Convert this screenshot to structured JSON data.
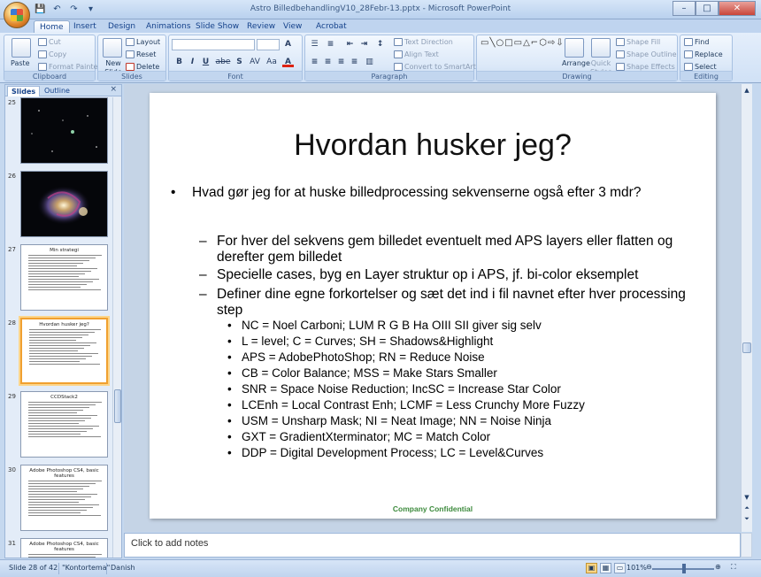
{
  "window": {
    "title": "Astro BilledbehandlingV10_28Febr-13.pptx - Microsoft PowerPoint",
    "minimize": "–",
    "maximize": "□",
    "close": "✕"
  },
  "qat": {
    "save": "💾",
    "undo": "↶",
    "redo": "↷",
    "more": "▾"
  },
  "tabs": [
    "Home",
    "Insert",
    "Design",
    "Animations",
    "Slide Show",
    "Review",
    "View",
    "Acrobat"
  ],
  "active_tab": "Home",
  "ribbon": {
    "clipboard": {
      "label": "Clipboard",
      "paste": "Paste",
      "cut": "Cut",
      "copy": "Copy",
      "format_painter": "Format Painter"
    },
    "slides": {
      "label": "Slides",
      "new_slide": "New Slide",
      "layout": "Layout",
      "reset": "Reset",
      "delete": "Delete"
    },
    "font": {
      "label": "Font",
      "bold": "B",
      "italic": "I",
      "underline": "U",
      "strike": "abe",
      "shadow": "S",
      "spacing": "AV",
      "case": "Aa",
      "color": "A"
    },
    "paragraph": {
      "label": "Paragraph",
      "text_direction": "Text Direction",
      "align_text": "Align Text",
      "convert_smartart": "Convert to SmartArt"
    },
    "drawing": {
      "label": "Drawing",
      "arrange": "Arrange",
      "quick_styles": "Quick Styles",
      "shape_fill": "Shape Fill",
      "shape_outline": "Shape Outline",
      "shape_effects": "Shape Effects"
    },
    "editing": {
      "label": "Editing",
      "find": "Find",
      "replace": "Replace",
      "select": "Select"
    }
  },
  "left_pane": {
    "tab_slides": "Slides",
    "tab_outline": "Outline",
    "close": "×",
    "thumbs": [
      {
        "num": "25",
        "title": "",
        "kind": "stars"
      },
      {
        "num": "26",
        "title": "",
        "kind": "galaxy"
      },
      {
        "num": "27",
        "title": "Min strategi",
        "kind": "text"
      },
      {
        "num": "28",
        "title": "Hvordan husker jeg?",
        "kind": "text",
        "selected": true
      },
      {
        "num": "29",
        "title": "CCDStack2",
        "kind": "text"
      },
      {
        "num": "30",
        "title": "Adobe Photoshop CS4, basic features",
        "kind": "text"
      },
      {
        "num": "31",
        "title": "Adobe Photoshop CS4, basic features",
        "kind": "text"
      }
    ]
  },
  "slide": {
    "title": "Hvordan husker jeg?",
    "bullet1": "Hvad gør jeg for at huske billedprocessing sekvenserne også efter 3 mdr?",
    "sub": [
      "For hver del sekvens gem billedet eventuelt med APS layers eller flatten og derefter gem billedet",
      "Specielle cases, byg en Layer struktur op i APS, jf. bi-color eksemplet",
      "Definer dine egne forkortelser og sæt det ind i fil navnet efter hver processing step"
    ],
    "abbreviations": [
      "NC = Noel Carboni; LUM R G B Ha OIII SII giver sig selv",
      "L = level; C = Curves; SH = Shadows&Highlight",
      "APS = AdobePhotoShop; RN = Reduce Noise",
      "CB = Color Balance; MSS = Make Stars Smaller",
      "SNR = Space Noise Reduction; IncSC = Increase Star Color",
      "LCEnh = Local Contrast Enh; LCMF = Less Crunchy More Fuzzy",
      "USM = Unsharp Mask; NI = Neat Image; NN = Noise Ninja",
      "GXT = GradientXterminator; MC = Match Color",
      "DDP = Digital Development Process; LC = Level&Curves"
    ],
    "footer": "Company Confidential"
  },
  "notes": {
    "placeholder": "Click to add notes"
  },
  "status": {
    "slide_info": "Slide 28 of 42",
    "theme": "\"Kontortema\"",
    "language": "Danish",
    "zoom": "101%"
  }
}
